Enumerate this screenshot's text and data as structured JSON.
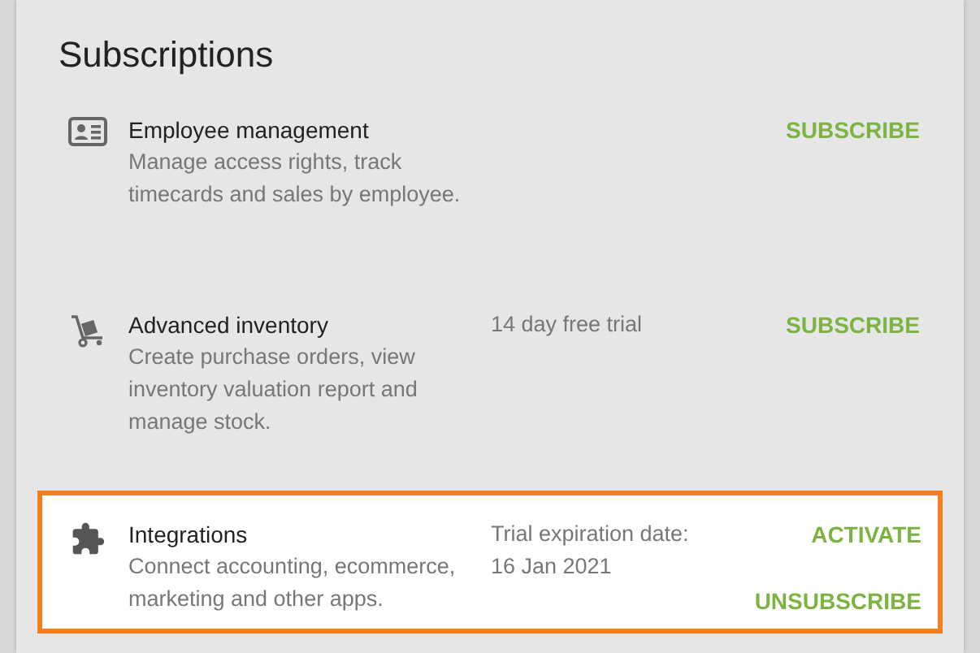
{
  "title": "Subscriptions",
  "items": [
    {
      "name": "Employee management",
      "description": "Manage access rights, track timecards and sales by employee.",
      "actions": [
        "SUBSCRIBE"
      ],
      "highlighted": false
    },
    {
      "name": "Advanced inventory",
      "description": "Create purchase orders, view inventory valuation report and manage stock.",
      "status": "14 day free trial",
      "actions": [
        "SUBSCRIBE"
      ],
      "highlighted": false
    },
    {
      "name": "Integrations",
      "description": "Connect accounting, ecommerce, marketing and other apps.",
      "status": "Trial expiration date: 16 Jan 2021",
      "actions": [
        "ACTIVATE",
        "UNSUBSCRIBE"
      ],
      "highlighted": true
    }
  ]
}
